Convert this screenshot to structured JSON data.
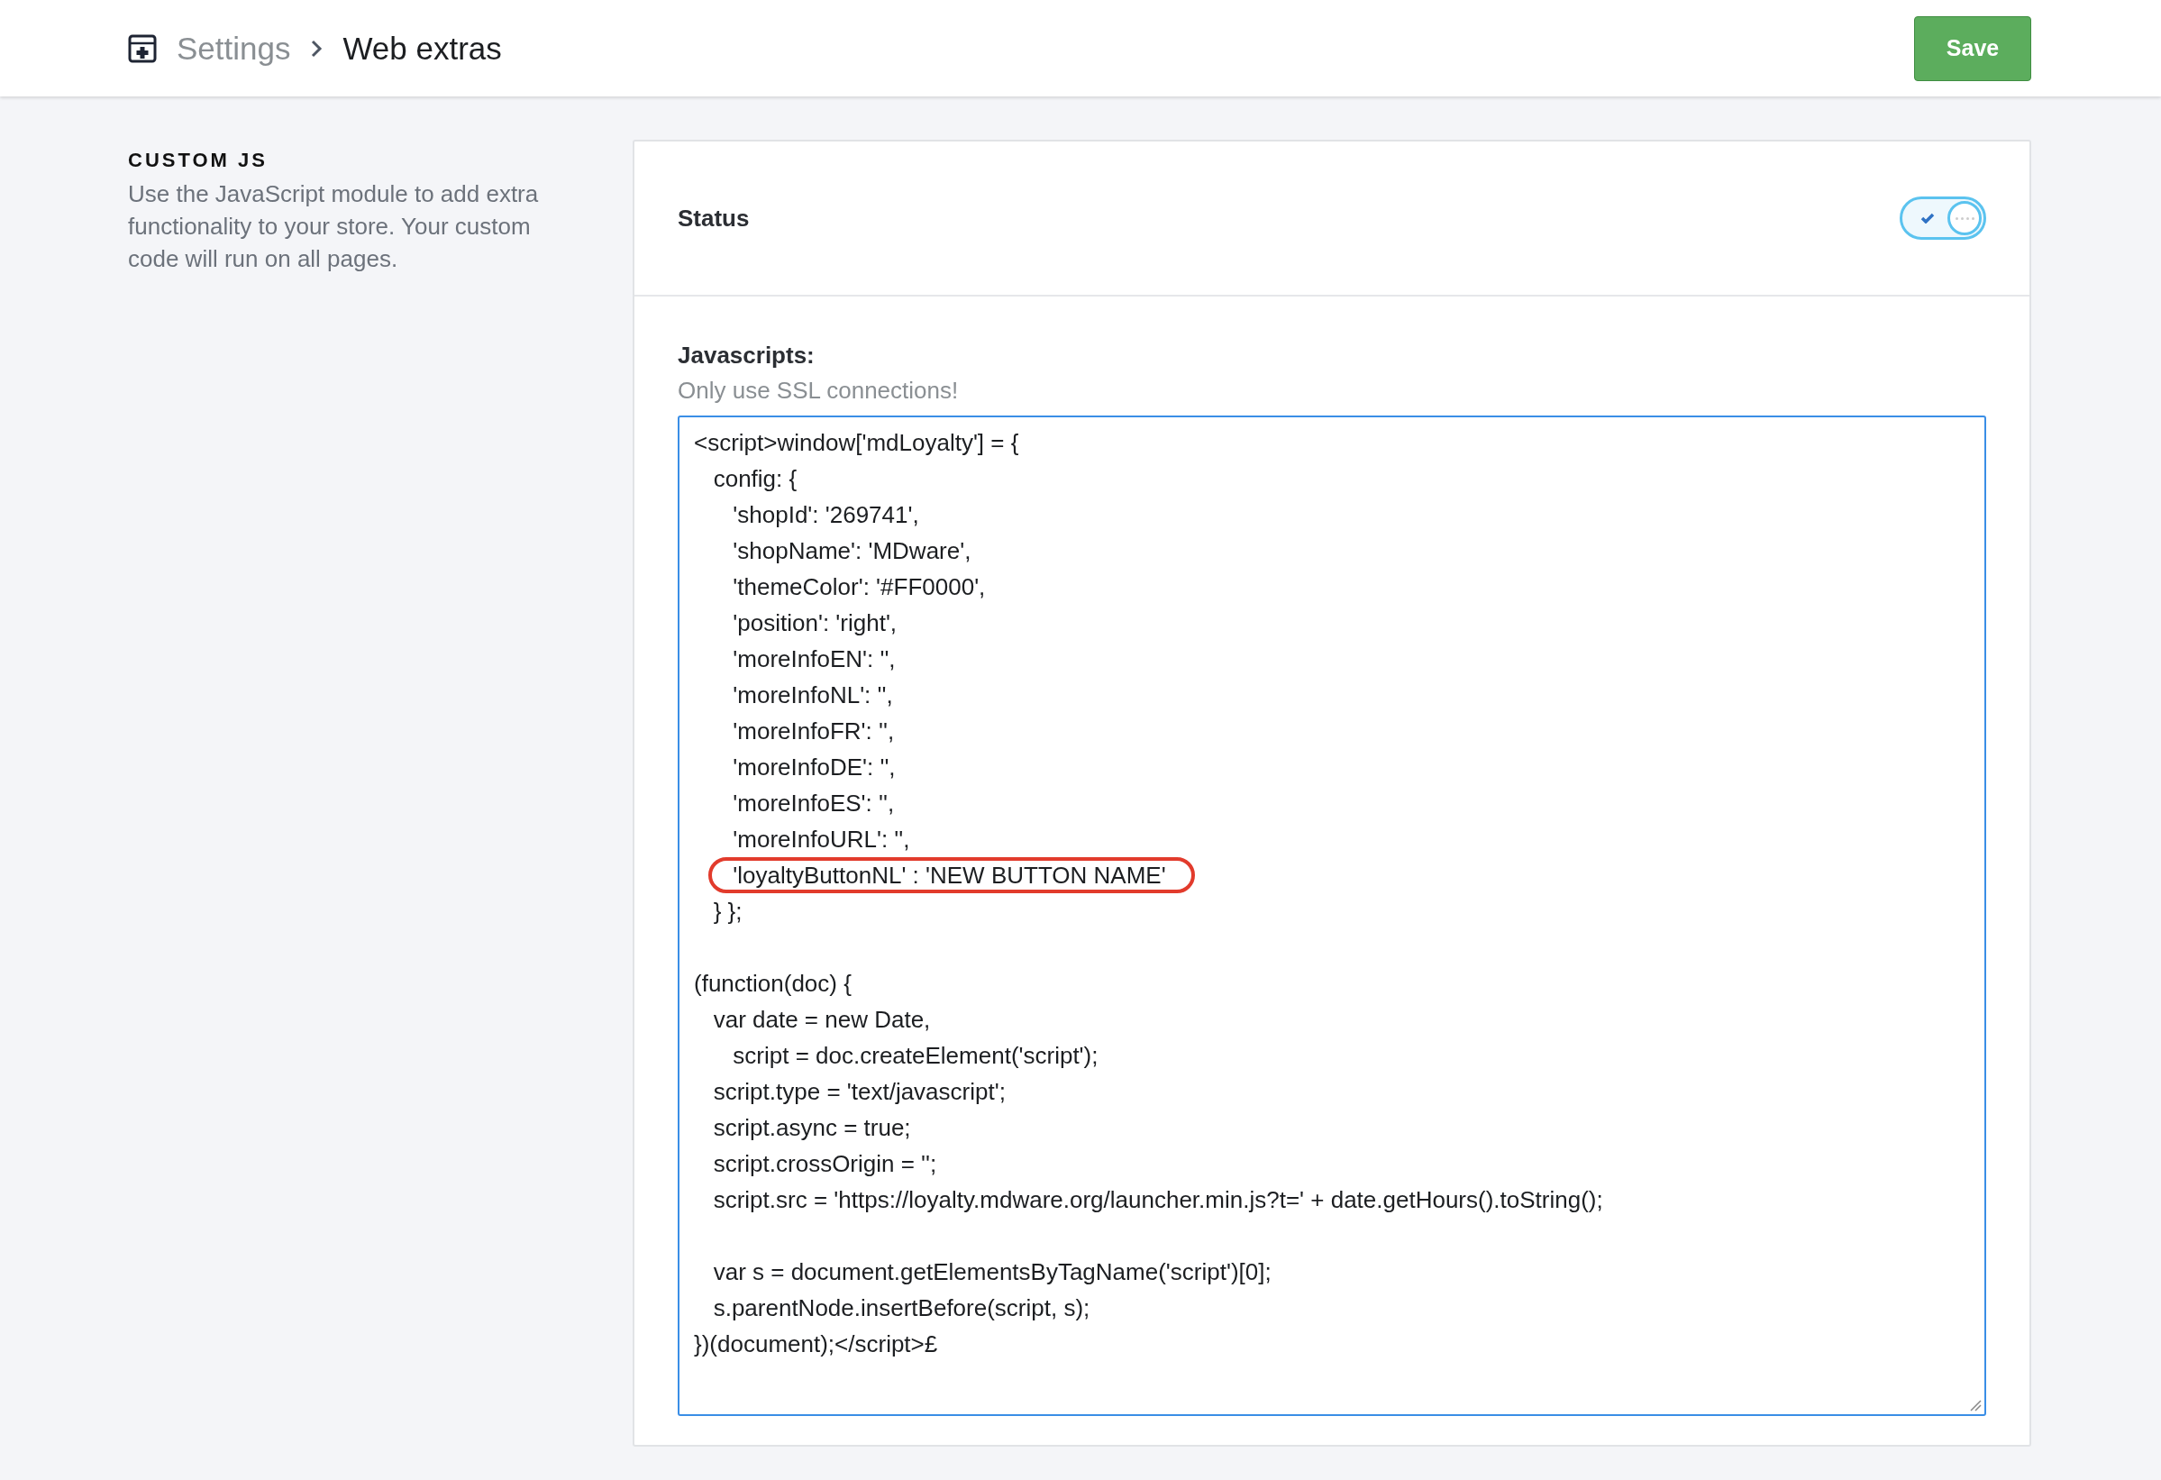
{
  "header": {
    "breadcrumb": [
      {
        "label": "Settings",
        "current": false
      },
      {
        "label": "Web extras",
        "current": true
      }
    ],
    "save_button": "Save"
  },
  "section": {
    "title": "CUSTOM JS",
    "description": "Use the JavaScript module to add extra functionality to your store. Your custom code will run on all pages."
  },
  "status": {
    "label": "Status",
    "on": true
  },
  "scripts": {
    "label": "Javascripts:",
    "hint": "Only use SSL connections!",
    "code_blocks": [
      [
        {
          "text": "<script>window['mdLoyalty'] = {",
          "circled": false
        },
        {
          "text": "   config: {",
          "circled": false
        },
        {
          "text": "      'shopId': '269741',",
          "circled": false
        },
        {
          "text": "      'shopName': 'MDware',",
          "circled": false
        },
        {
          "text": "      'themeColor': '#FF0000',",
          "circled": false
        },
        {
          "text": "      'position': 'right',",
          "circled": false
        },
        {
          "text": "      'moreInfoEN': '',",
          "circled": false
        },
        {
          "text": "      'moreInfoNL': '',",
          "circled": false
        },
        {
          "text": "      'moreInfoFR': '',",
          "circled": false
        },
        {
          "text": "      'moreInfoDE': '',",
          "circled": false
        },
        {
          "text": "      'moreInfoES': '',",
          "circled": false
        },
        {
          "text": "      'moreInfoURL': '',",
          "circled": false
        },
        {
          "text": "      'loyaltyButtonNL' : 'NEW BUTTON NAME'",
          "circled": true
        },
        {
          "text": "   } };",
          "circled": false
        }
      ],
      [
        {
          "text": "(function(doc) {",
          "circled": false
        },
        {
          "text": "   var date = new Date,",
          "circled": false
        },
        {
          "text": "      script = doc.createElement('script');",
          "circled": false
        },
        {
          "text": "   script.type = 'text/javascript';",
          "circled": false
        },
        {
          "text": "   script.async = true;",
          "circled": false
        },
        {
          "text": "   script.crossOrigin = '';",
          "circled": false
        },
        {
          "text": "   script.src = 'https://loyalty.mdware.org/launcher.min.js?t=' + date.getHours().toString();",
          "circled": false
        }
      ],
      [
        {
          "text": "   var s = document.getElementsByTagName('script')[0];",
          "circled": false
        },
        {
          "text": "   s.parentNode.insertBefore(script, s);",
          "circled": false
        },
        {
          "text": "})(document);</script>£",
          "circled": false
        }
      ]
    ]
  }
}
